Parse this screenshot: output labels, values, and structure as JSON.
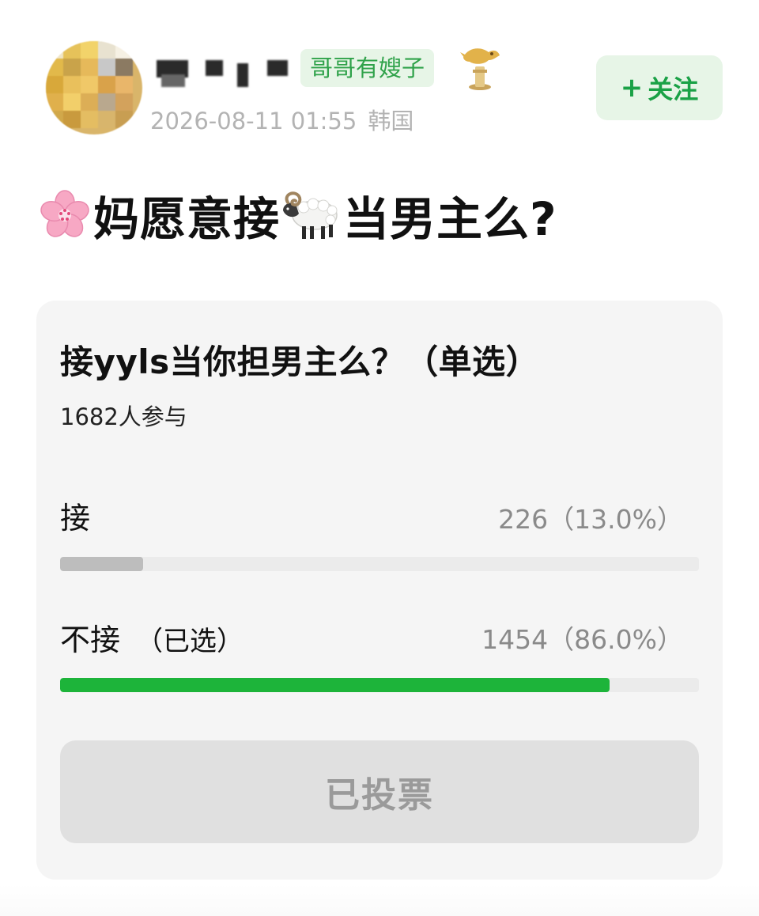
{
  "header": {
    "tag": "哥哥有嫂子",
    "timestamp": "2026-08-11 01:55",
    "location": "韩国",
    "follow_label": "关注",
    "follow_plus": "+"
  },
  "post": {
    "title_part1": "妈愿意接",
    "title_part2": "当男主么?",
    "emoji_1": "cherry-blossom",
    "emoji_2": "ram"
  },
  "poll": {
    "question": "接yyls当你担男主么？（单选）",
    "participants": "1682人参与",
    "options": [
      {
        "label": "接",
        "selected_note": "",
        "count_text": "226（13.0%）",
        "percent": 13.0,
        "bar_color": "#bdbdbd"
      },
      {
        "label": "不接",
        "selected_note": "（已选）",
        "count_text": "1454（86.0%）",
        "percent": 86.0,
        "bar_color": "#1db43a"
      }
    ],
    "voted_label": "已投票"
  },
  "colors": {
    "accent_green": "#1aa146",
    "badge_bg": "#e7f5e7",
    "card_bg": "#f5f5f5",
    "muted_text": "#b3b3b3"
  }
}
